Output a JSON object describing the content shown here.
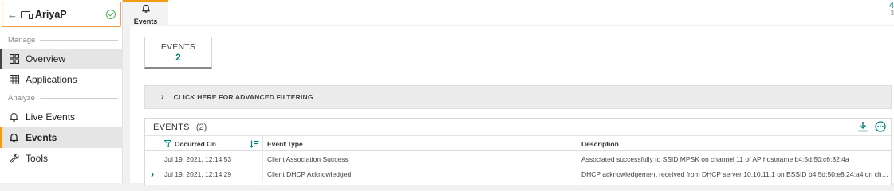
{
  "device": {
    "name": "AriyaP",
    "icons": {
      "back": "arrow-left-icon",
      "device": "device-icon",
      "status": "check-circle-icon"
    }
  },
  "sidebar": {
    "sections": [
      {
        "label": "Manage"
      },
      {
        "label": "Analyze"
      }
    ],
    "items": [
      {
        "label": "Overview",
        "icon": "grid-icon"
      },
      {
        "label": "Applications",
        "icon": "apps-icon"
      },
      {
        "label": "Live Events",
        "icon": "bell-icon"
      },
      {
        "label": "Events",
        "icon": "bell-icon"
      },
      {
        "label": "Tools",
        "icon": "wrench-icon"
      }
    ]
  },
  "topbar": {
    "tab_label": "Events",
    "corner_top": "4",
    "corner_bottom": "3"
  },
  "summary": {
    "label": "EVENTS",
    "count": "2"
  },
  "filter": {
    "label": "CLICK HERE FOR ADVANCED FILTERING"
  },
  "table": {
    "title": "EVENTS",
    "count": "(2)",
    "headers": [
      "Occurred On",
      "Event Type",
      "Description"
    ],
    "rows": [
      {
        "occurred": "Jul 19, 2021, 12:14:53",
        "type": "Client Association Success",
        "description": "Associated successfully to SSID MPSK on channel 11 of AP hostname b4:5d:50:c6:82:4a",
        "expandable": false
      },
      {
        "occurred": "Jul 19, 2021, 12:14:29",
        "type": "Client DHCP Acknowledged",
        "description": "DHCP acknowledgement received from DHCP server 10.10.11.1 on BSSID b4:5d:50:e8:24:a4 on ch…",
        "expandable": true
      }
    ]
  },
  "colors": {
    "accent": "#f39c12",
    "teal": "#00857c",
    "status_ok": "#4caf50"
  }
}
